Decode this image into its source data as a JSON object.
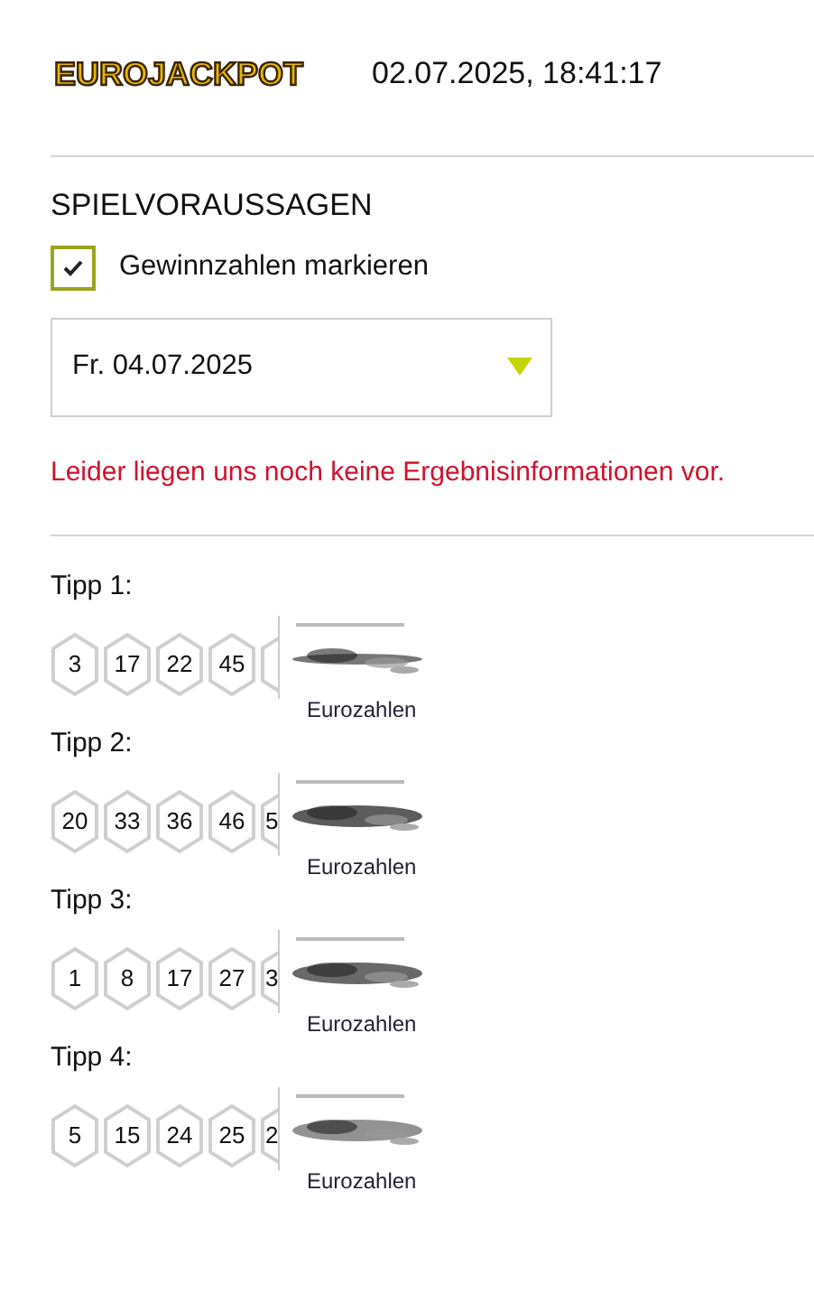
{
  "header": {
    "logo": "EUROJACKPOT",
    "datetime": "02.07.2025, 18:41:17"
  },
  "section": {
    "title": "SPIELVORAUSSAGEN",
    "checkbox": {
      "label": "Gewinnzahlen markieren",
      "checked": true
    },
    "select": {
      "value": "Fr. 04.07.2025"
    },
    "message": "Leider liegen uns noch keine Ergebnisinformationen vor."
  },
  "tips": [
    {
      "label": "Tipp 1:",
      "numbers": [
        "3",
        "17",
        "22",
        "45"
      ],
      "euro_label": "Eurozahlen"
    },
    {
      "label": "Tipp 2:",
      "numbers": [
        "20",
        "33",
        "36",
        "46"
      ],
      "cut_number": "5",
      "euro_label": "Eurozahlen"
    },
    {
      "label": "Tipp 3:",
      "numbers": [
        "1",
        "8",
        "17",
        "27"
      ],
      "cut_number": "3",
      "euro_label": "Eurozahlen"
    },
    {
      "label": "Tipp 4:",
      "numbers": [
        "5",
        "15",
        "24",
        "25"
      ],
      "cut_number": "2",
      "euro_label": "Eurozahlen"
    }
  ]
}
